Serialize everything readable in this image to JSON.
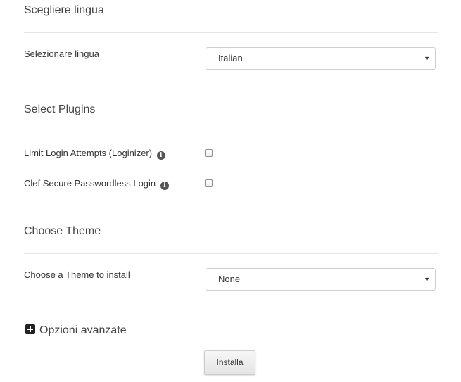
{
  "language_section": {
    "title": "Scegliere lingua",
    "label": "Selezionare lingua",
    "selected": "Italian"
  },
  "plugins_section": {
    "title": "Select Plugins",
    "items": [
      {
        "label": "Limit Login Attempts (Loginizer)",
        "checked": false,
        "info_icon": "info-icon"
      },
      {
        "label": "Clef Secure Passwordless Login",
        "checked": false,
        "info_icon": "info-icon"
      }
    ]
  },
  "theme_section": {
    "title": "Choose Theme",
    "label": "Choose a Theme to install",
    "selected": "None"
  },
  "advanced": {
    "label": "Opzioni avanzate",
    "icon": "plus-square-icon"
  },
  "install_button": {
    "label": "Installa"
  },
  "glyphs": {
    "info": "i",
    "dropdown_arrow": "▼"
  }
}
